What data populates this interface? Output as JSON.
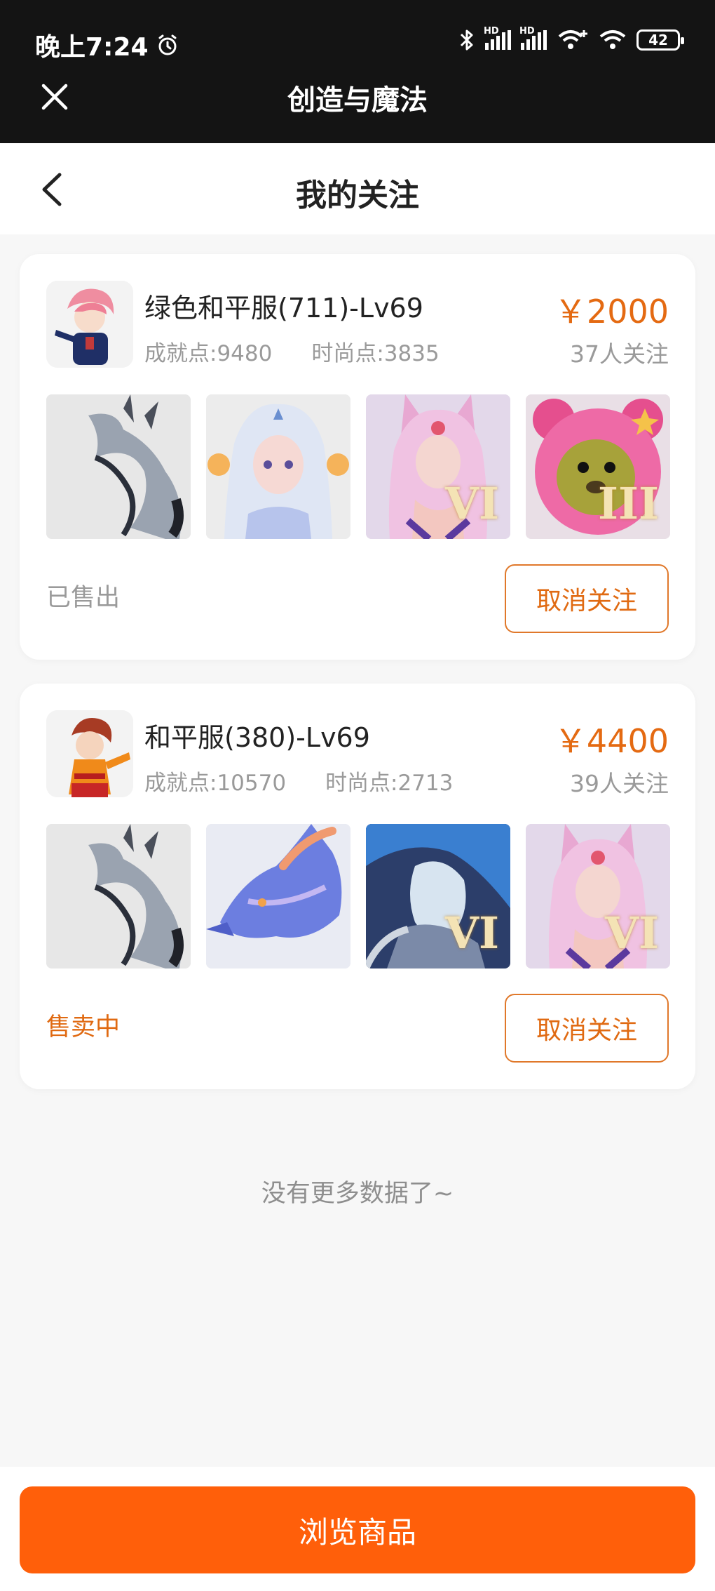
{
  "status_bar": {
    "time": "晚上7:24",
    "battery": "42",
    "network_hd_1": "HD",
    "network_hd_2": "HD"
  },
  "app_bar": {
    "title": "创造与魔法"
  },
  "page": {
    "title": "我的关注"
  },
  "listings": [
    {
      "title": "绿色和平服(711)-Lv69",
      "achievement": "成就点:9480",
      "fashion": "时尚点:3835",
      "price": "￥2000",
      "followers": "37人关注",
      "status": "已售出",
      "status_color": "#9a9a9a",
      "action": "取消关注",
      "thumbs": [
        {
          "icon": "silver-dragon-mount-icon"
        },
        {
          "icon": "white-hair-girl-icon"
        },
        {
          "icon": "pink-fox-girl-icon",
          "rank": "VI"
        },
        {
          "icon": "pink-bear-costume-icon",
          "rank": "III"
        }
      ]
    },
    {
      "title": "和平服(380)-Lv69",
      "achievement": "成就点:10570",
      "fashion": "时尚点:2713",
      "price": "￥4400",
      "followers": "39人关注",
      "status": "售卖中",
      "status_color": "#e06a12",
      "action": "取消关注",
      "thumbs": [
        {
          "icon": "silver-dragon-mount-icon"
        },
        {
          "icon": "blue-dragon-head-icon"
        },
        {
          "icon": "ice-dragon-rider-icon",
          "rank": "VI"
        },
        {
          "icon": "pink-fox-girl-icon",
          "rank": "VI"
        }
      ]
    }
  ],
  "footer_note": "没有更多数据了~",
  "bottom_button": "浏览商品",
  "colors": {
    "accent": "#ff5f0a",
    "price": "#e46a12",
    "topbar": "#141414"
  }
}
